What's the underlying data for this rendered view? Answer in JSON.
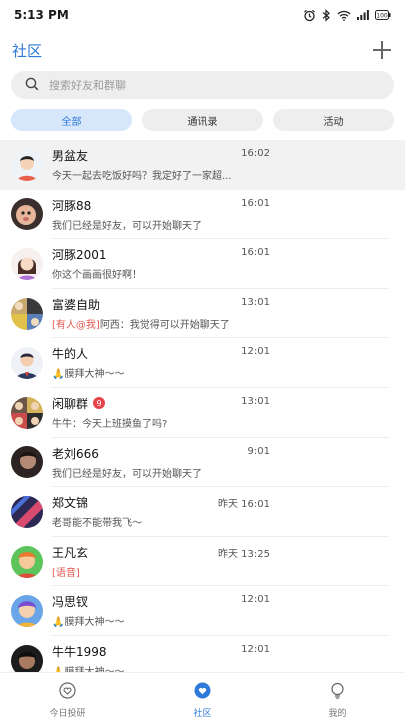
{
  "status": {
    "time": "5:13 PM",
    "battery": "100"
  },
  "header": {
    "title": "社区"
  },
  "search": {
    "placeholder": "搜索好友和群聊"
  },
  "tabs": [
    {
      "label": "全部",
      "active": true
    },
    {
      "label": "通讯录",
      "active": false
    },
    {
      "label": "活动",
      "active": false
    }
  ],
  "chats": [
    {
      "name": "男盆友",
      "time": "16:02",
      "message": "今天一起去吃饭好吗？我定好了一家超...",
      "avatar": "boy-cartoon"
    },
    {
      "name": "河豚88",
      "time": "16:01",
      "message": "我们已经是好友，可以开始聊天了",
      "avatar": "baby-photo"
    },
    {
      "name": "河豚2001",
      "time": "16:01",
      "message": "你这个画画很好啊！",
      "avatar": "girl-cartoon"
    },
    {
      "name": "富婆自助",
      "time": "13:01",
      "mention": "[有人@我]",
      "message": "阿西：我觉得可以开始聊天了",
      "avatar": "group-grid"
    },
    {
      "name": "牛的人",
      "time": "12:01",
      "message": "🙏膜拜大神～～",
      "avatar": "man-suit"
    },
    {
      "name": "闲聊群",
      "badge": "9",
      "time": "13:01",
      "message": "牛牛：今天上班摸鱼了吗?",
      "avatar": "group-grid"
    },
    {
      "name": "老刘666",
      "time": "9:01",
      "message": "我们已经是好友，可以开始聊天了",
      "avatar": "dark-photo"
    },
    {
      "name": "郑文锦",
      "time": "昨天 16:01",
      "message": "老哥能不能带我飞～",
      "avatar": "abstract"
    },
    {
      "name": "王凡玄",
      "time": "昨天 13:25",
      "voice": "[语音]",
      "message": "",
      "avatar": "green-cartoon"
    },
    {
      "name": "冯思钗",
      "time": "12:01",
      "message": "🙏膜拜大神～～",
      "avatar": "blue-cartoon"
    },
    {
      "name": "牛牛1998",
      "time": "12:01",
      "message": "🙏膜拜大神～～",
      "avatar": "dark-photo"
    }
  ],
  "bottom_nav": [
    {
      "label": "今日投研",
      "icon": "heart-outline-icon",
      "active": false
    },
    {
      "label": "社区",
      "icon": "heart-filled-icon",
      "active": true
    },
    {
      "label": "我的",
      "icon": "person-bulb-icon",
      "active": false
    }
  ],
  "colors": {
    "accent": "#2f7ad9",
    "mention": "#e0584f",
    "badge": "#e8434a"
  }
}
